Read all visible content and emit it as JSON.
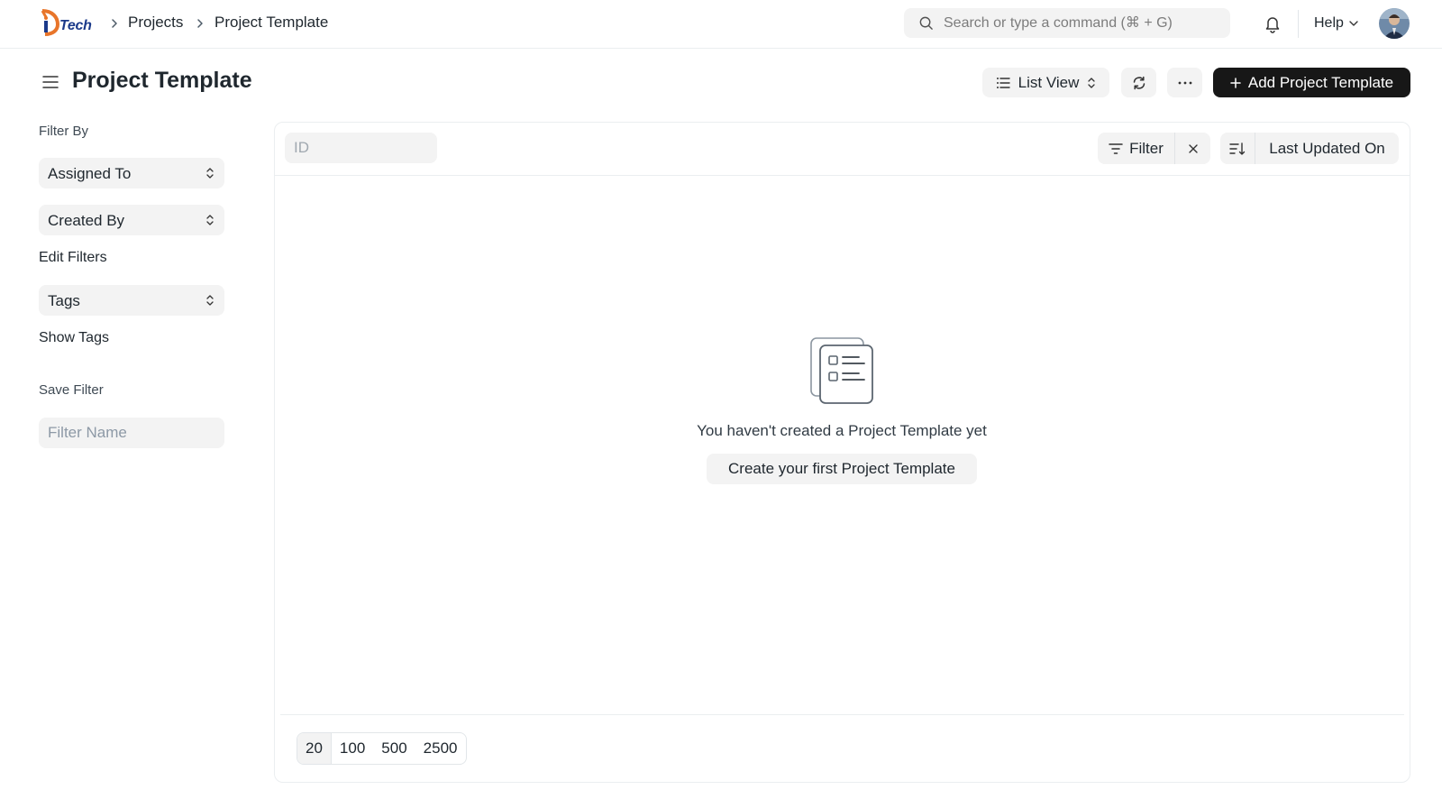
{
  "navbar": {
    "logo_text": "Tech",
    "breadcrumbs": [
      "Projects",
      "Project Template"
    ],
    "search": {
      "placeholder": "Search or type a command (⌘ + G)"
    },
    "help_label": "Help"
  },
  "page": {
    "title": "Project Template",
    "list_view_label": "List View",
    "primary_button_label": "Add Project Template"
  },
  "sidebar": {
    "filter_by_label": "Filter By",
    "assigned_to_label": "Assigned To",
    "created_by_label": "Created By",
    "edit_filters_label": "Edit Filters",
    "tags_label": "Tags",
    "show_tags_label": "Show Tags",
    "save_filter_label": "Save Filter",
    "filter_name_placeholder": "Filter Name"
  },
  "list": {
    "id_placeholder": "ID",
    "filter_label": "Filter",
    "sort_label": "Last Updated On",
    "empty_message": "You haven't created a Project Template yet",
    "create_button_label": "Create your first Project Template",
    "page_sizes": [
      "20",
      "100",
      "500",
      "2500"
    ]
  },
  "colors": {
    "primary_button": "#171717",
    "control_background": "#f3f3f3",
    "border": "#ebeef0",
    "logo_orange": "#e8752a",
    "logo_blue": "#1b3a8a"
  }
}
